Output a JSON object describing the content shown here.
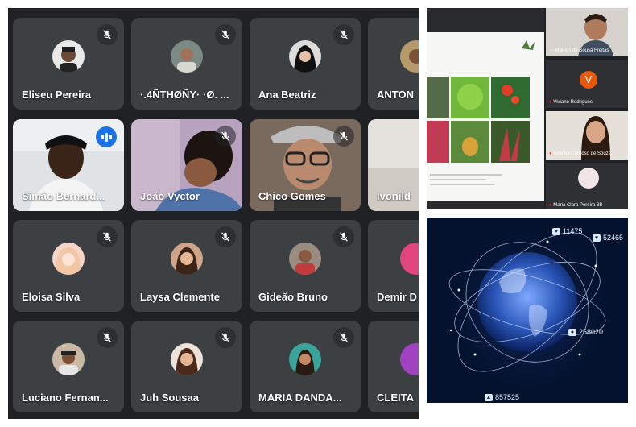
{
  "meet_grid": {
    "participants": [
      {
        "name": "Eliseu Pereira",
        "status": "muted"
      },
      {
        "name": "·.4ÑTHØÑY· ·Ø. ...",
        "status": "muted"
      },
      {
        "name": "Ana Beatriz",
        "status": "muted"
      },
      {
        "name": "ANTON",
        "status": "muted"
      },
      {
        "name": "Simão Bernard...",
        "status": "speaking"
      },
      {
        "name": "João Vyctor",
        "status": "muted"
      },
      {
        "name": "Chico Gomes",
        "status": "muted"
      },
      {
        "name": "Ivonild",
        "status": "muted"
      },
      {
        "name": "Eloisa Silva",
        "status": "muted"
      },
      {
        "name": "Laysa Clemente",
        "status": "muted"
      },
      {
        "name": "Gideão Bruno",
        "status": "muted"
      },
      {
        "name": "Demir D",
        "status": "muted"
      },
      {
        "name": "Luciano Fernan...",
        "status": "muted"
      },
      {
        "name": "Juh Sousaa",
        "status": "muted"
      },
      {
        "name": "MARIA DANDA...",
        "status": "muted"
      },
      {
        "name": "CLEITA",
        "status": "muted"
      }
    ]
  },
  "presentation_call": {
    "participants": [
      {
        "name": "Mateus de Sousa Freitas",
        "icon": "more-dots-icon"
      },
      {
        "name": "Viviane Rodrigues",
        "initial": "V",
        "avatar_color": "#e8590c"
      },
      {
        "name": "Andréia Cardoso de Souza"
      },
      {
        "name": "Maria Clara Pereira 3B"
      }
    ]
  },
  "globe_image": {
    "stats": [
      {
        "icon": "heart-icon",
        "value": "11475"
      },
      {
        "icon": "heart-icon",
        "value": "52465"
      },
      {
        "icon": "user-icon",
        "value": "258020"
      },
      {
        "icon": "like-icon",
        "value": "857525"
      }
    ]
  },
  "colors": {
    "meet_bg": "#202124",
    "tile_bg": "#3c4043",
    "speaking_blue": "#1a73e8",
    "active_outline": "#8ab4f8",
    "muted_red": "#ea4335"
  }
}
